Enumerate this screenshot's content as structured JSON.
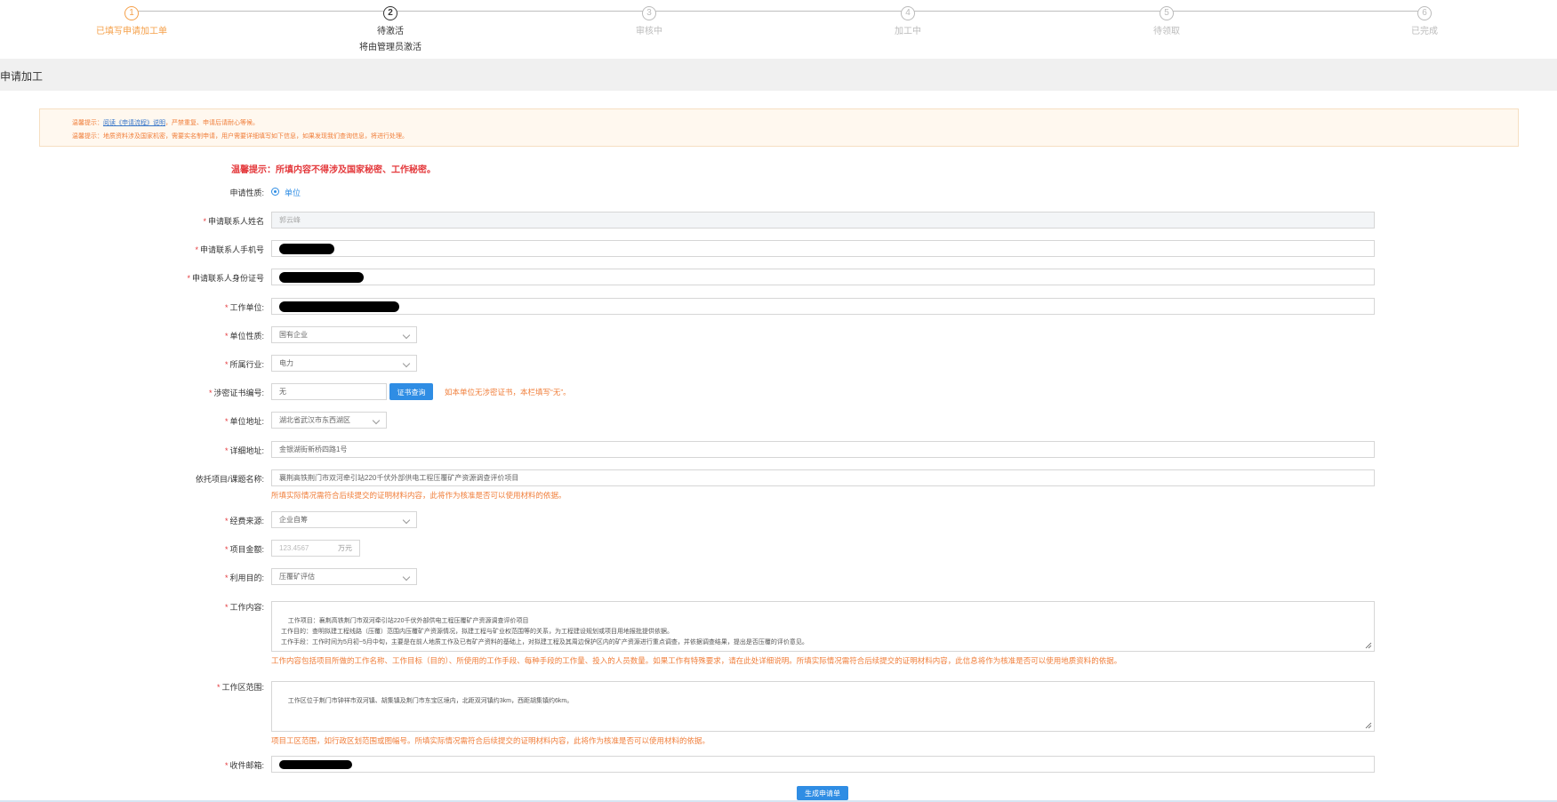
{
  "steps": [
    {
      "num": "1",
      "label": "已填写申请加工单",
      "desc": ""
    },
    {
      "num": "2",
      "label": "待激活",
      "desc": "将由管理员激活"
    },
    {
      "num": "3",
      "label": "审核中",
      "desc": ""
    },
    {
      "num": "4",
      "label": "加工中",
      "desc": ""
    },
    {
      "num": "5",
      "label": "待领取",
      "desc": ""
    },
    {
      "num": "6",
      "label": "已完成",
      "desc": ""
    }
  ],
  "header": {
    "title": "申请加工"
  },
  "notice": {
    "line1_prefix": "温馨提示：",
    "line1_link": "阅读《申请流程》说明",
    "line1_suffix": "，严禁重复、申请后请耐心等候。",
    "line2": "温馨提示：地质资料涉及国家机密，需要实名制申请，用户需要详细填写如下信息，如果发现我们查询信息，将进行处理。"
  },
  "warning": "温馨提示：所填内容不得涉及国家秘密、工作秘密。",
  "form": {
    "nature": {
      "label": "申请性质:",
      "option": "单位"
    },
    "contact_name": {
      "label": "申请联系人姓名",
      "value": "郭云峰"
    },
    "contact_phone": {
      "label": "申请联系人手机号"
    },
    "contact_id": {
      "label": "申请联系人身份证号"
    },
    "work_unit": {
      "label": "工作单位:"
    },
    "unit_nature": {
      "label": "单位性质:",
      "value": "国有企业"
    },
    "industry": {
      "label": "所属行业:",
      "value": "电力"
    },
    "cert_no": {
      "label": "涉密证书编号:",
      "value": "无",
      "button": "证书查询",
      "hint": "如本单位无涉密证书，本栏填写“无”。"
    },
    "unit_address": {
      "label": "单位地址:",
      "value": "湖北省武汉市东西湖区"
    },
    "detail_address": {
      "label": "详细地址:",
      "value": "金银湖街新桥四路1号"
    },
    "project": {
      "label": "依托项目/课题名称:",
      "value": "襄荆高铁荆门市双河牵引站220千伏外部供电工程压覆矿产资源调查评价项目",
      "hint": "所填实际情况需符合后续提交的证明材料内容，此将作为核准是否可以使用材料的依据。"
    },
    "funding": {
      "label": "经费来源:",
      "value": "企业自筹"
    },
    "amount": {
      "label": "项目金额:",
      "placeholder": "123.4567",
      "unit": "万元"
    },
    "purpose": {
      "label": "利用目的:",
      "value": "压覆矿评估"
    },
    "work_content": {
      "label": "工作内容:",
      "value": "工作项目：襄荆高铁荆门市双河牵引站220千伏外部供电工程压覆矿产资源调查评价项目\n工作目的：查明拟建工程线路（压覆）范围内压覆矿产资源情况，拟建工程与矿业权范围等的关系，为工程建设规划或项目用地报批提供依据。\n工作手段：工作时间为5月初~5月中旬，主要是在前人地质工作及已有矿产资料的基础上，对拟建工程及其周边保护区内的矿产资源进行重点调查，并依据调查结果，提出是否压覆的评价意见。",
      "hint": "工作内容包括项目所做的工作名称、工作目标（目的）、所使用的工作手段、每种手段的工作量、投入的人员数量。如果工作有特殊要求，请在此处详细说明。所填实际情况需符合后续提交的证明材料内容，此信息将作为核准是否可以使用地质资料的依据。"
    },
    "work_area": {
      "label": "工作区范围:",
      "value": "工作区位于荆门市钟祥市双河镇、胡集镇及荆门市东宝区境内，北距双河镇约3km，西距胡集镇约6km。",
      "hint": "项目工区范围，如行政区划范围或图幅号。所填实际情况需符合后续提交的证明材料内容，此将作为核准是否可以使用材料的依据。"
    },
    "email": {
      "label": "收件邮箱:"
    }
  },
  "submit_label": "生成申请单",
  "colors": {
    "accent": "#2f8de4",
    "warning": "#f07e3a",
    "error": "#e4393c",
    "step_done": "#f5a04a"
  }
}
